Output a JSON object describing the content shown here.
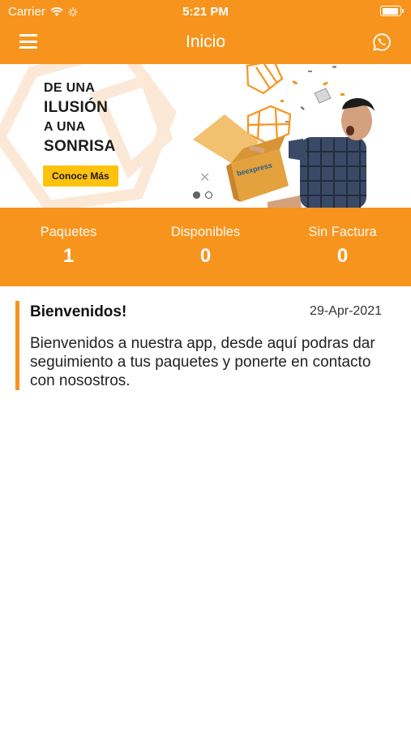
{
  "status_bar": {
    "carrier": "Carrier",
    "time": "5:21 PM"
  },
  "navbar": {
    "title": "Inicio",
    "menu_icon": "hamburger-menu-icon",
    "action_icon": "whatsapp-icon"
  },
  "banner": {
    "lines": [
      "DE UNA",
      "ILUSIÓN",
      "A UNA",
      "SONRISA"
    ],
    "cta_label": "Conoce Más",
    "box_brand": "beexpress",
    "close_glyph": "✕",
    "page_count": 2,
    "active_page": 1
  },
  "stats": [
    {
      "label": "Paquetes",
      "value": "1"
    },
    {
      "label": "Disponibles",
      "value": "0"
    },
    {
      "label": "Sin Factura",
      "value": "0"
    }
  ],
  "message": {
    "title": "Bienvenidos!",
    "date": "29-Apr-2021",
    "body": "Bienvenidos a nuestra app, desde aquí podras dar seguimiento a tus paquetes y ponerte en contacto con nosostros."
  },
  "colors": {
    "brand": "#f7941d",
    "cta": "#ffc20e"
  }
}
